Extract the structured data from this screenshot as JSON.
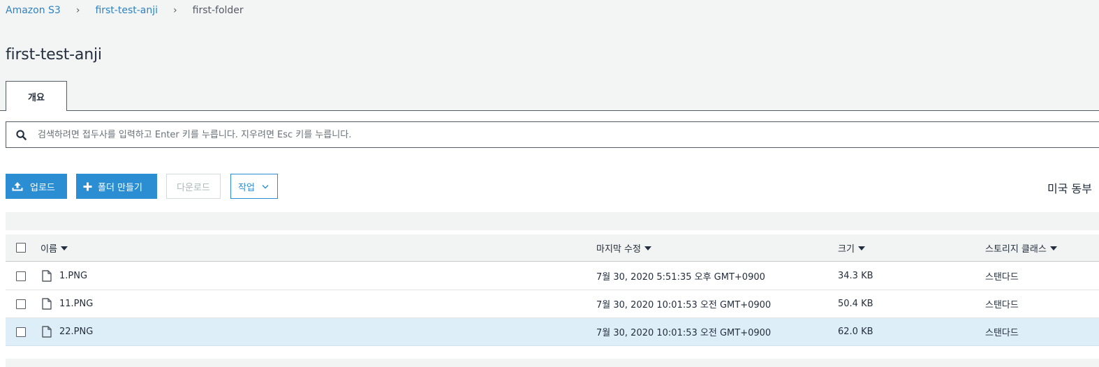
{
  "breadcrumb": {
    "root": "Amazon S3",
    "bucket": "first-test-anji",
    "folder": "first-folder",
    "separator": "›"
  },
  "page_title": "first-test-anji",
  "tabs": [
    {
      "label": "개요",
      "active": true
    }
  ],
  "search": {
    "placeholder": "검색하려면 접두사를 입력하고 Enter 키를 누릅니다. 지우려면 Esc 키를 누릅니다.",
    "value": ""
  },
  "toolbar": {
    "upload_label": "업로드",
    "create_folder_label": "폴더 만들기",
    "download_label": "다운로드",
    "actions_label": "작업",
    "region_text": "미국 동부"
  },
  "table": {
    "columns": [
      {
        "label": "이름"
      },
      {
        "label": "마지막 수정"
      },
      {
        "label": "크기"
      },
      {
        "label": "스토리지 클래스"
      }
    ],
    "rows": [
      {
        "name": "1.PNG",
        "modified": "7월 30, 2020 5:51:35 오후 GMT+0900",
        "size": "34.3 KB",
        "storage": "스탠다드",
        "selected": false
      },
      {
        "name": "11.PNG",
        "modified": "7월 30, 2020 10:01:53 오전 GMT+0900",
        "size": "50.4 KB",
        "storage": "스탠다드",
        "selected": false
      },
      {
        "name": "22.PNG",
        "modified": "7월 30, 2020 10:01:53 오전 GMT+0900",
        "size": "62.0 KB",
        "storage": "스탠다드",
        "selected": true
      }
    ]
  },
  "icons": {
    "search": "search-icon",
    "upload": "upload-icon",
    "folder_add": "plus-icon",
    "actions_dropdown": "chevron-down-icon",
    "file": "file-icon",
    "sort": "sort-caret-icon"
  },
  "colors": {
    "primary": "#2b8ed3",
    "link": "#2e82c4",
    "selected_row": "#deeef8",
    "header_bg": "#f2f3f3",
    "page_bg": "#f3f5f5"
  }
}
